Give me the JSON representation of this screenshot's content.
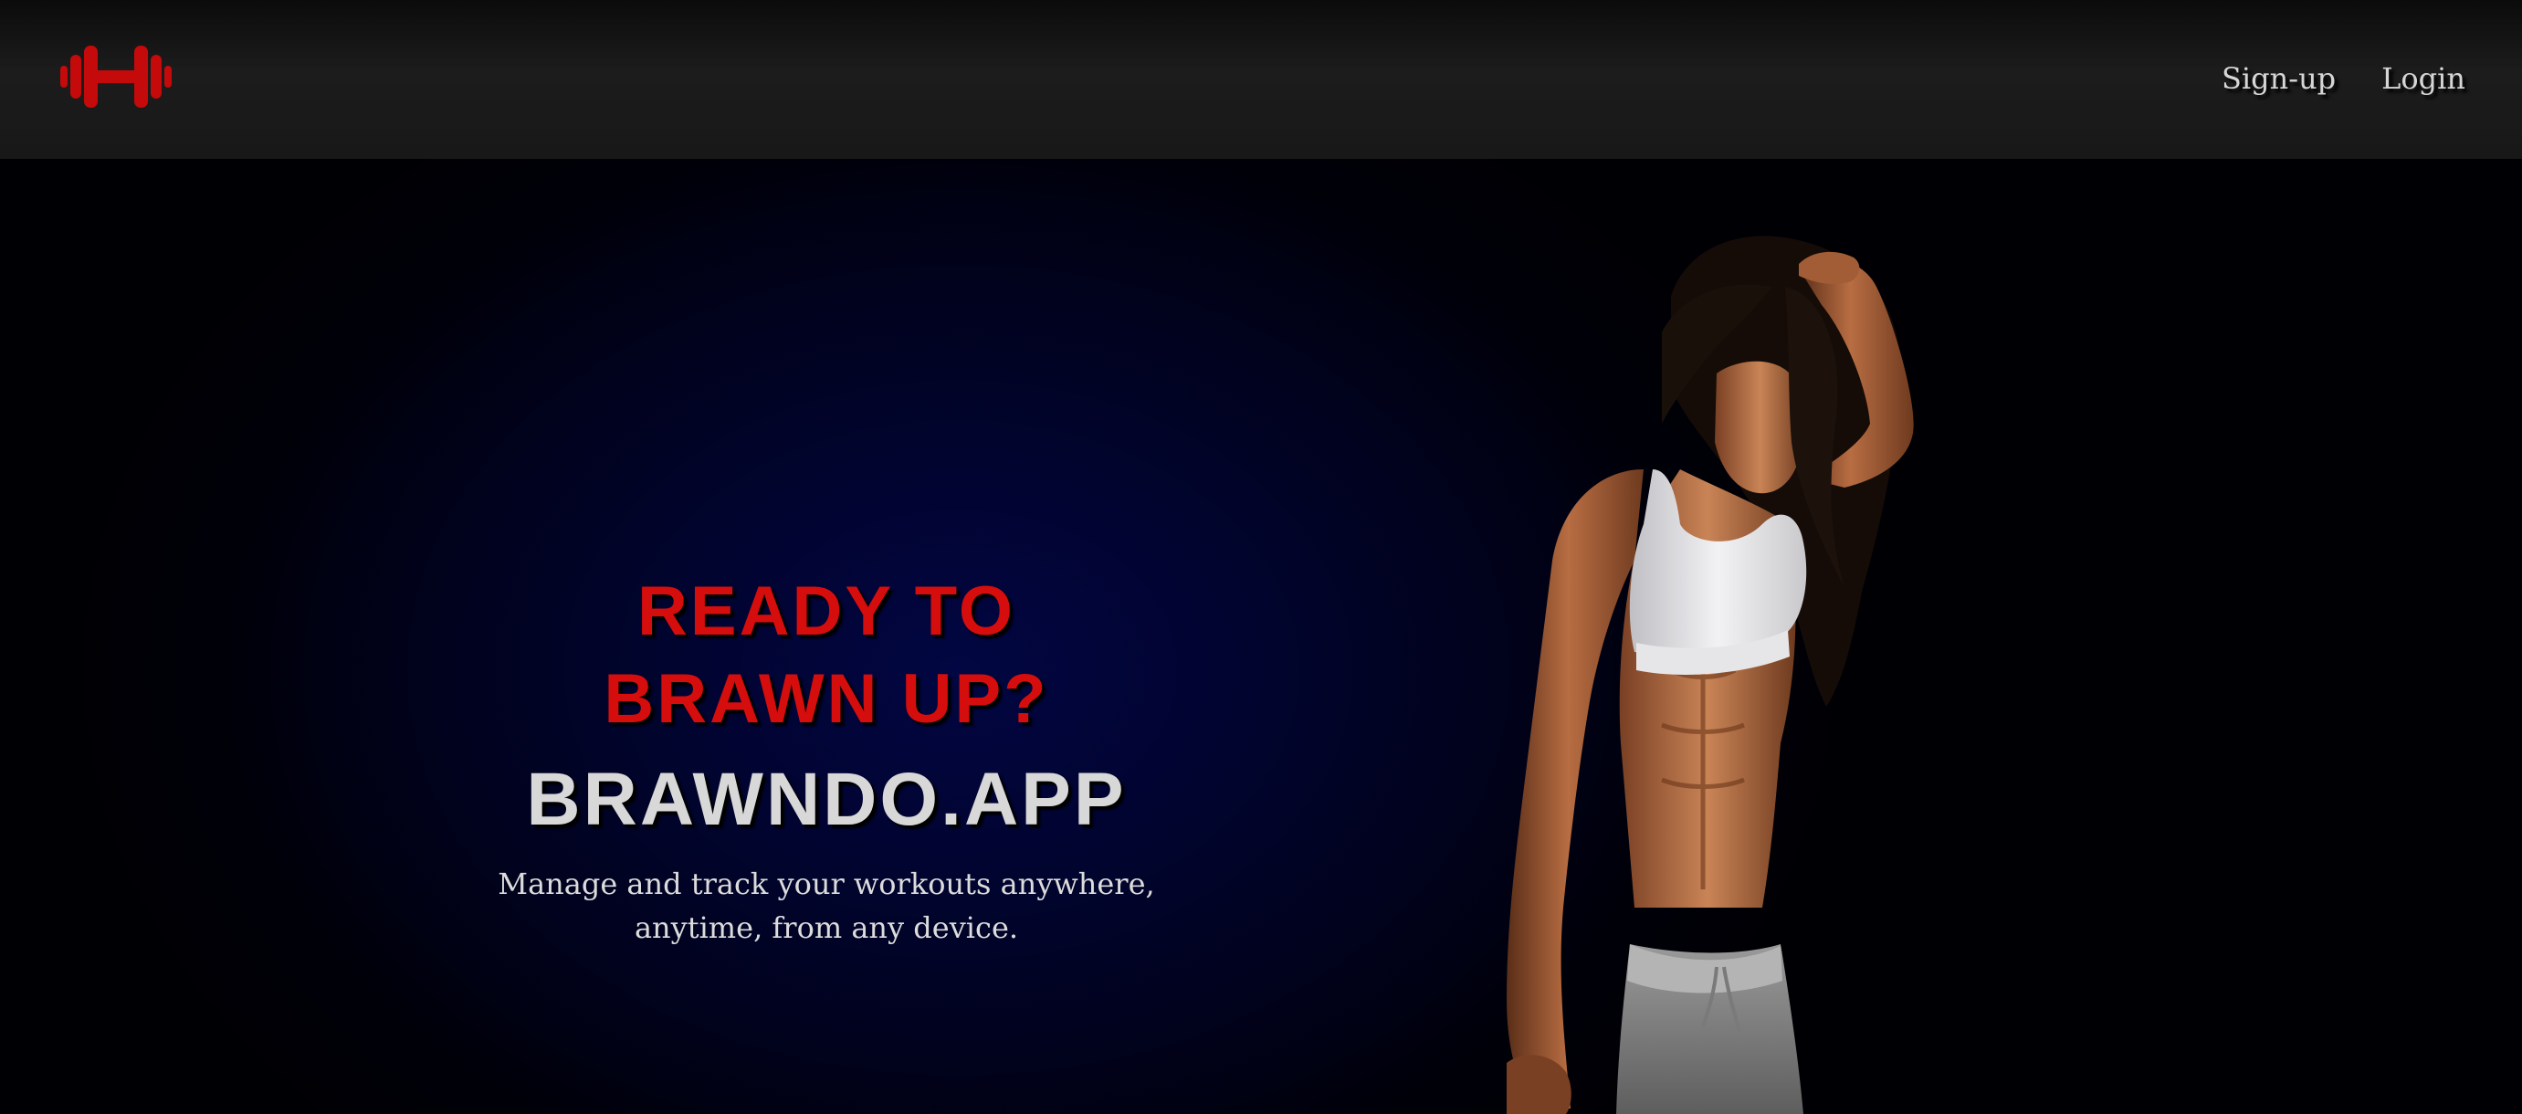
{
  "navbar": {
    "logo_icon": "dumbbell-icon",
    "links": [
      {
        "label": "Sign-up"
      },
      {
        "label": "Login"
      }
    ]
  },
  "hero": {
    "headline_line1": "READY TO",
    "headline_line2": "BRAWN UP?",
    "brand": "BRAWNDO.APP",
    "tagline_line1": "Manage and track your workouts anywhere,",
    "tagline_line2": "anytime, from any device.",
    "image": "woman-athlete-photo"
  },
  "colors": {
    "accent": "#d50d0d",
    "navbar": "#1a1a1a",
    "hero_background": "#01032e",
    "text": "#d8d8d8"
  }
}
